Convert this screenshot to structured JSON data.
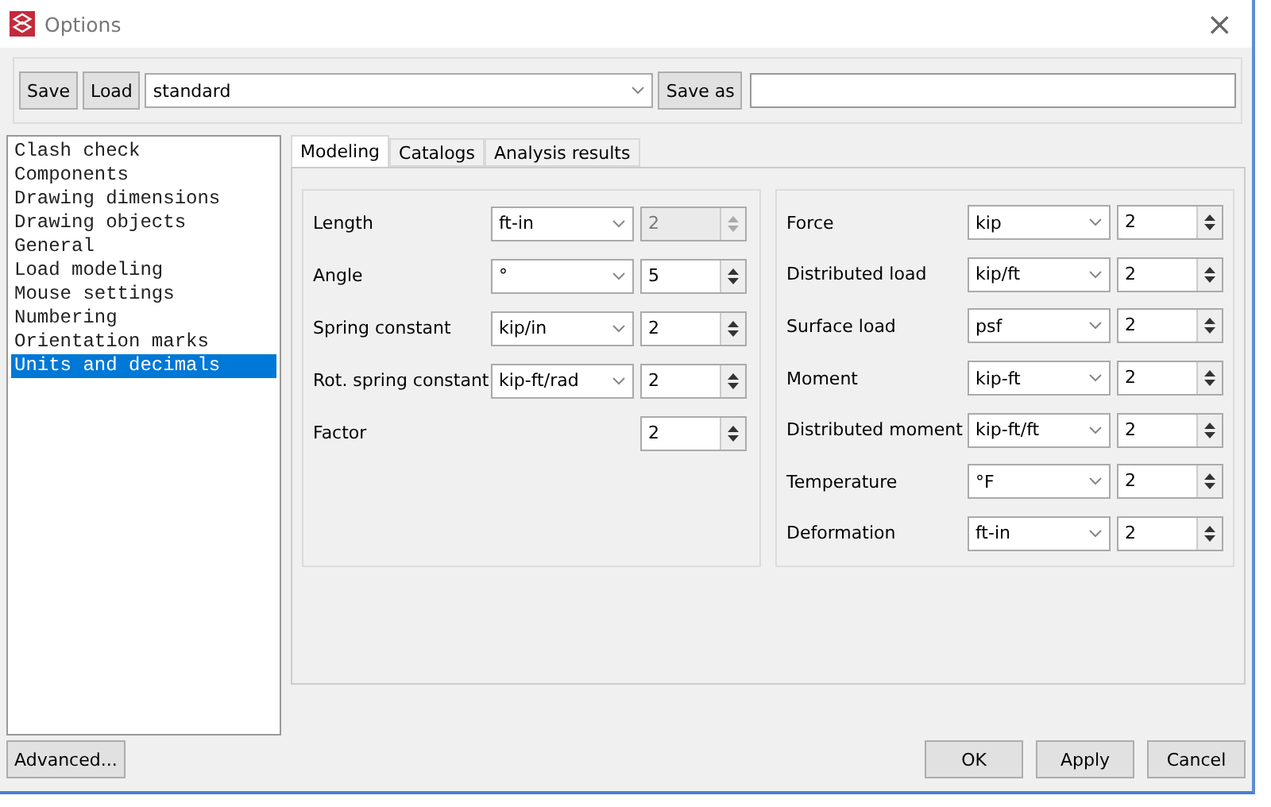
{
  "window": {
    "title": "Options",
    "close": "×"
  },
  "toolbar": {
    "buttons": [
      "Save",
      "Load"
    ],
    "preset": "standard",
    "save_as": "Save as"
  },
  "sidebar": {
    "items": [
      {
        "label": "Clash check",
        "selected": false
      },
      {
        "label": "Components",
        "selected": false
      },
      {
        "label": "Drawing dimensions",
        "selected": false
      },
      {
        "label": "Drawing objects",
        "selected": false
      },
      {
        "label": "General",
        "selected": false
      },
      {
        "label": "Load modeling",
        "selected": false
      },
      {
        "label": "Mouse settings",
        "selected": false
      },
      {
        "label": "Numbering",
        "selected": false
      },
      {
        "label": "Orientation marks",
        "selected": false
      },
      {
        "label": "Units and decimals",
        "selected": true
      }
    ]
  },
  "tabs": [
    {
      "label": "Modeling",
      "selected": true
    },
    {
      "label": "Catalogs",
      "selected": false
    },
    {
      "label": "Analysis results",
      "selected": false
    }
  ],
  "groups": [
    {
      "rows": [
        {
          "label": "Length",
          "unit": "ft-in",
          "decimals": "2",
          "disabled": true
        },
        {
          "label": "Angle",
          "unit": "°",
          "decimals": "5",
          "disabled": false
        },
        {
          "label": "Spring constant",
          "unit": "kip/in",
          "decimals": "2",
          "disabled": false
        },
        {
          "label": "Rot. spring constant",
          "unit": "kip-ft/rad",
          "decimals": "2",
          "disabled": false
        },
        {
          "label": "Factor",
          "decimals": "2",
          "disabled": false
        }
      ]
    },
    {
      "rows": [
        {
          "label": "Force",
          "unit": "kip",
          "decimals": "2",
          "disabled": false
        },
        {
          "label": "Distributed load",
          "unit": "kip/ft",
          "decimals": "2",
          "disabled": false
        },
        {
          "label": "Surface load",
          "unit": "psf",
          "decimals": "2",
          "disabled": false
        },
        {
          "label": "Moment",
          "unit": "kip-ft",
          "decimals": "2",
          "disabled": false
        },
        {
          "label": "Distributed moment",
          "unit": "kip-ft/ft",
          "decimals": "2",
          "disabled": false
        },
        {
          "label": "Temperature",
          "unit": "°F",
          "decimals": "2",
          "disabled": false
        },
        {
          "label": "Deformation",
          "unit": "ft-in",
          "decimals": "2",
          "disabled": false
        }
      ]
    }
  ],
  "footer": {
    "advanced": "Advanced...",
    "buttons": [
      "OK",
      "Apply",
      "Cancel"
    ]
  }
}
